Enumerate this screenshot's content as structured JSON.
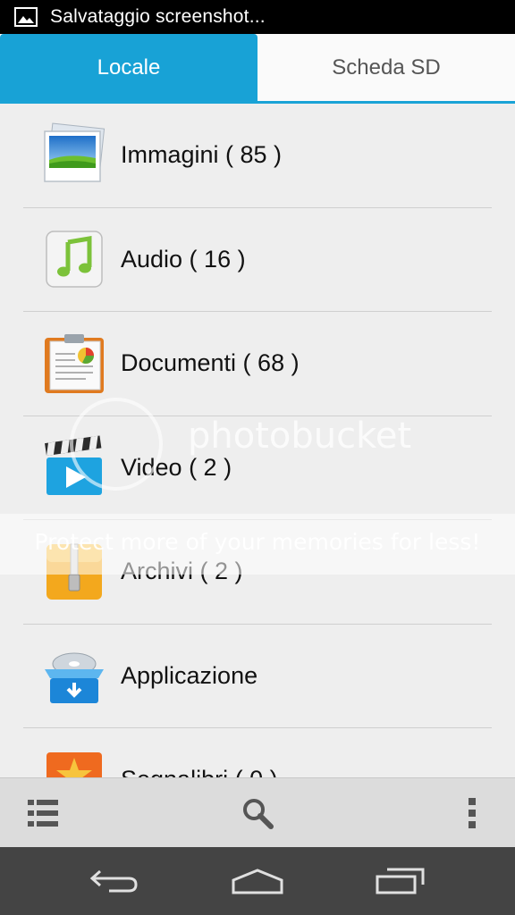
{
  "status_bar": {
    "notification_text": "Salvataggio screenshot..."
  },
  "tabs": [
    {
      "label": "Locale",
      "active": true
    },
    {
      "label": "Scheda SD",
      "active": false
    }
  ],
  "categories": [
    {
      "label": "Immagini ( 85 )",
      "icon": "images-icon"
    },
    {
      "label": "Audio ( 16 )",
      "icon": "audio-icon"
    },
    {
      "label": "Documenti ( 68 )",
      "icon": "documents-icon"
    },
    {
      "label": "Video ( 2 )",
      "icon": "video-icon"
    },
    {
      "label": "Archivi ( 2 )",
      "icon": "archive-icon"
    },
    {
      "label": "Applicazione",
      "icon": "application-icon"
    },
    {
      "label": "Segnalibri ( 0 )",
      "icon": "bookmarks-icon"
    }
  ],
  "watermark": {
    "logo_text": "photobucket",
    "tagline": "Protect more of your memories for less!"
  },
  "colors": {
    "accent": "#18a2d6",
    "nav_bar": "#444444",
    "bottom_bar": "#dcdcdc"
  }
}
